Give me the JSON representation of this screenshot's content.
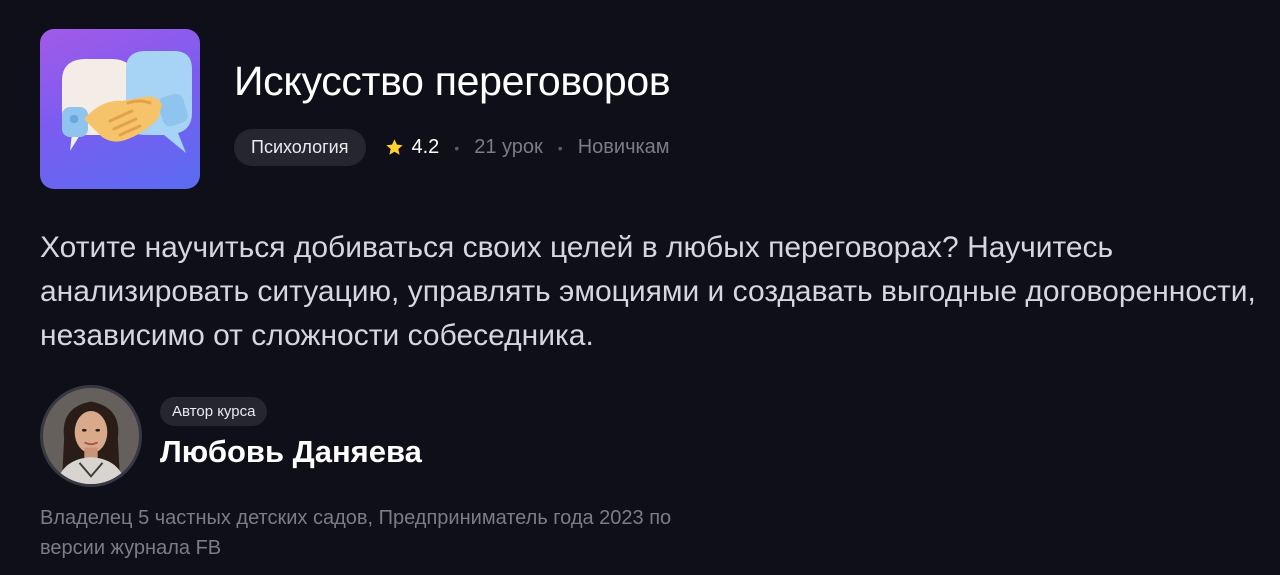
{
  "course": {
    "title": "Искусство переговоров",
    "category": "Психология",
    "rating": "4.2",
    "lessons": "21 урок",
    "level": "Новичкам",
    "description": "Хотите научиться добиваться своих целей в любых переговорах? Научитесь анализировать ситуацию, управлять эмоциями и создавать выгодные договоренности, независимо от сложности собеседника.",
    "cover_icon": "handshake-speech-bubbles-icon"
  },
  "meta_separator": "•",
  "author": {
    "badge": "Автор курса",
    "name": "Любовь Даняева",
    "bio": "Владелец 5 частных детских садов, Предприниматель года 2023 по версии журнала FB",
    "avatar": "author-portrait"
  },
  "colors": {
    "background": "#0f0f19",
    "chip_background": "#262631",
    "muted_text": "#7c7c87",
    "star": "#ffd233",
    "cover_gradient_start": "#a35ae8",
    "cover_gradient_end": "#5a6cf2"
  }
}
